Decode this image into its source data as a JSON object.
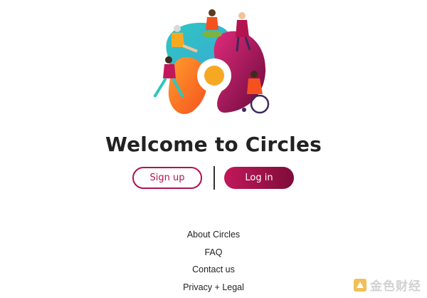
{
  "welcome": {
    "title": "Welcome to Circles"
  },
  "actions": {
    "signup_label": "Sign up",
    "login_label": "Log in"
  },
  "footer": {
    "links": [
      {
        "label": "About Circles"
      },
      {
        "label": "FAQ"
      },
      {
        "label": "Contact us"
      },
      {
        "label": "Privacy + Legal"
      }
    ]
  },
  "watermark": {
    "text": "金色财经"
  },
  "colors": {
    "brand_primary": "#b3134f",
    "brand_dark": "#7e0c3a",
    "accent_yellow": "#f7a823",
    "accent_teal": "#2fc6c0"
  }
}
